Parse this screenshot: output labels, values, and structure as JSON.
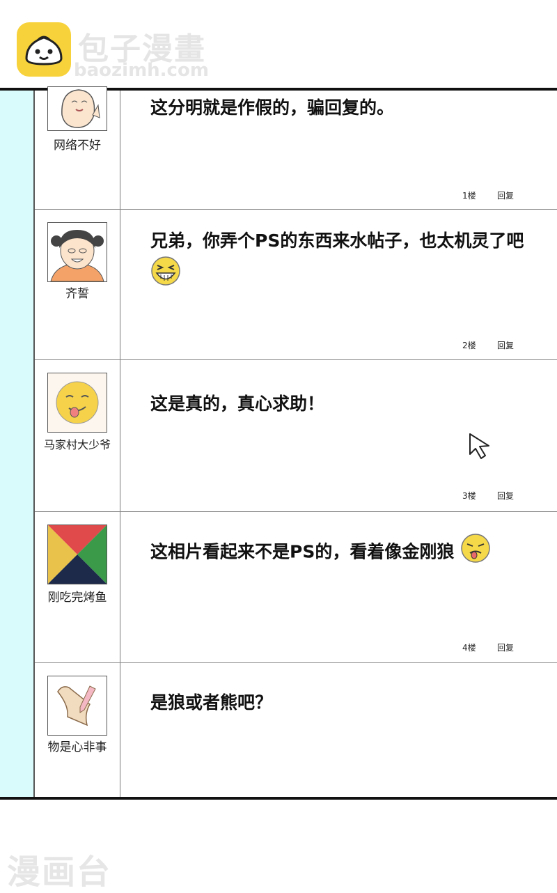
{
  "brand": {
    "name": "包子漫畫",
    "url": "baozimh.com"
  },
  "posts": [
    {
      "user": "网络不好",
      "avatar": "bald-baby-avatar",
      "text": "这分明就是作假的，骗回复的。",
      "floor": "1楼",
      "reply": "回复"
    },
    {
      "user": "齐誓",
      "avatar": "girl-avatar",
      "text": "兄弟，你弄个PS的东西来水帖子，也太机灵了吧",
      "emoji": "grin-emoji",
      "floor": "2楼",
      "reply": "回复"
    },
    {
      "user": "马家村大少爷",
      "avatar": "tongue-smiley-avatar",
      "text": "这是真的，真心求助！",
      "floor": "3楼",
      "reply": "回复"
    },
    {
      "user": "刚吃完烤鱼",
      "avatar": "color-tangram-avatar",
      "text": "这相片看起来不是PS的，看着像金刚狼",
      "emoji": "smirk-emoji",
      "floor": "4楼",
      "reply": "回复"
    },
    {
      "user": "物是心非事",
      "avatar": "paper-pencil-avatar",
      "text": "是狼或者熊吧？"
    }
  ],
  "footer": {
    "watermark": "漫画台"
  },
  "colors": {
    "left_bar": "#d9fbfc",
    "logo": "#f7d23a"
  }
}
